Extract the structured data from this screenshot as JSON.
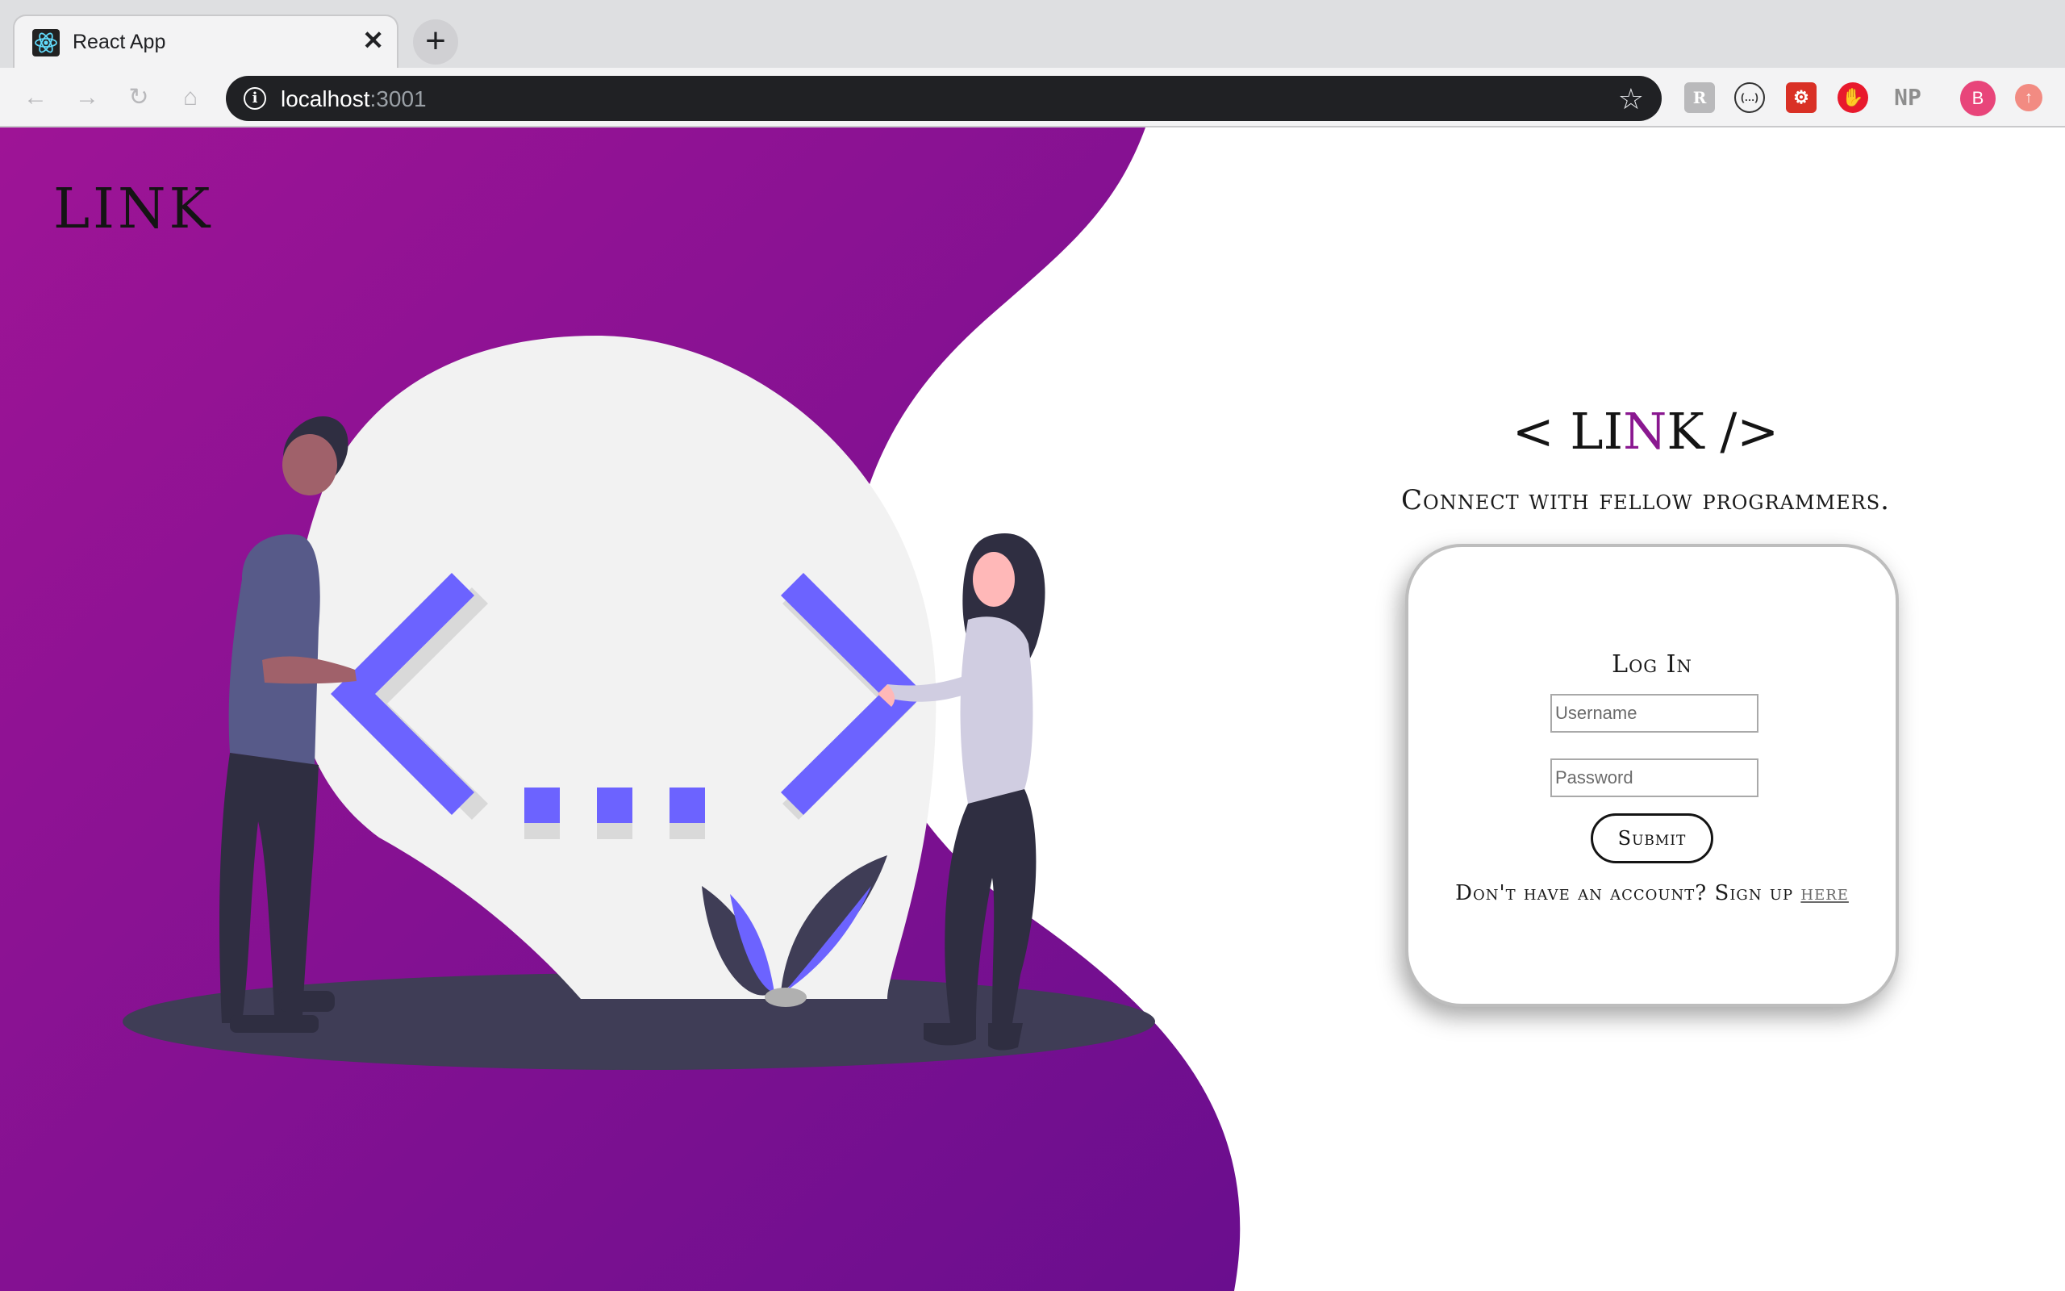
{
  "browser": {
    "tab_title": "React App",
    "tab_close": "✕",
    "new_tab": "+",
    "url_host": "localhost",
    "url_port": ":3001",
    "extensions": [
      "R",
      "(…)",
      "⚙",
      "✋",
      "NP",
      "B",
      "↑"
    ],
    "icons": {
      "favicon": "react-icon",
      "back": "back-arrow-icon",
      "forward": "forward-arrow-icon",
      "reload": "reload-icon",
      "home": "home-icon",
      "info": "info-icon",
      "bookmark": "star-icon"
    }
  },
  "page": {
    "brand": "LINK",
    "hero": {
      "prefix": "< LI",
      "accent": "N",
      "suffix": "K />"
    },
    "tagline": "Connect with fellow programmers.",
    "login": {
      "title": "Log In",
      "username_placeholder": "Username",
      "password_placeholder": "Password",
      "submit_label": "Submit",
      "signup_text": "Don't have an account? Sign up ",
      "signup_link": "here"
    },
    "colors": {
      "accent": "#8a1890",
      "gradient_start": "#9a1495",
      "gradient_end": "#6c0f8e",
      "illustration_blue": "#6c63ff"
    }
  }
}
